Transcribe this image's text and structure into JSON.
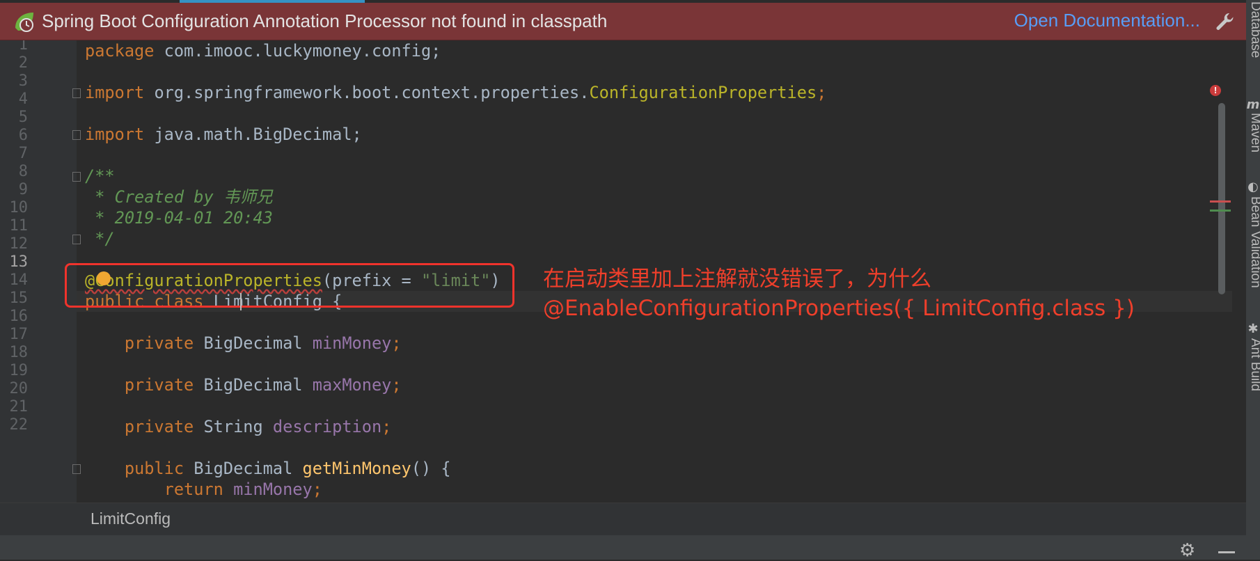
{
  "banner": {
    "message": "Spring Boot Configuration Annotation Processor not found in classpath",
    "link": "Open Documentation...",
    "icon": "spring-icon",
    "action_icon": "wrench-icon"
  },
  "side_tools": {
    "database": "Database",
    "maven": "Maven",
    "bean_validation": "Bean Validation",
    "ant_build": "Ant Build"
  },
  "editor": {
    "line_numbers": [
      "1",
      "2",
      "3",
      "4",
      "5",
      "6",
      "7",
      "8",
      "9",
      "10",
      "11",
      "12",
      "13",
      "14",
      "15",
      "16",
      "17",
      "18",
      "19",
      "20",
      "21",
      "22"
    ],
    "active_line": "13",
    "code": {
      "l1_kw": "package",
      "l1_rest": " com.imooc.luckymoney.config;",
      "l3_kw": "import",
      "l3_pkg": " org.springframework.boot.context.properties.",
      "l3_cls": "ConfigurationProperties",
      "l3_end": ";",
      "l5_kw": "import",
      "l5_rest": " java.math.BigDecimal;",
      "l7": "/**",
      "l8": " * Created by 韦师兄",
      "l9": " * 2019-04-01 20:43",
      "l10": " */",
      "l12_ann": "@ConfigurationProperties",
      "l12_open": "(prefix = ",
      "l12_str": "\"limit\"",
      "l12_close": ")",
      "l13_kw": "public class",
      "l13_rest": " LimitConfig {",
      "l15_kw": "    private",
      "l15_type": " BigDecimal ",
      "l15_fld": "minMoney",
      "l15_end": ";",
      "l17_kw": "    private",
      "l17_type": " BigDecimal ",
      "l17_fld": "maxMoney",
      "l17_end": ";",
      "l19_kw": "    private",
      "l19_type": " String ",
      "l19_fld": "description",
      "l19_end": ";",
      "l21_kw": "    public",
      "l21_type": " BigDecimal ",
      "l21_fn": "getMinMoney",
      "l21_end": "() {",
      "l22_kw": "        return",
      "l22_fld": " minMoney",
      "l22_end": ";"
    }
  },
  "annotation_note": {
    "line1": "在启动类里加上注解就没错误了，为什么",
    "line2": "@EnableConfigurationProperties({ LimitConfig.class })"
  },
  "breadcrumb": "LimitConfig",
  "error_marker": "!",
  "colors": {
    "banner_bg": "#7a3537",
    "link": "#589df6",
    "highlight": "#f0332c",
    "keyword": "#cc7832",
    "annotation": "#bbb529",
    "string": "#6a8759",
    "field": "#9876aa",
    "comment": "#629755"
  }
}
